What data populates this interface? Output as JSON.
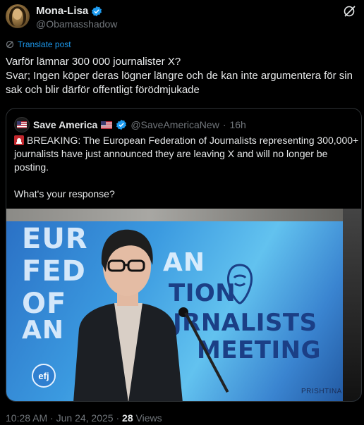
{
  "author": {
    "display_name": "Mona-Lisa",
    "handle": "@Obamasshadow",
    "verified_color": "#1d9bf0"
  },
  "translate_label": "Translate post",
  "post_text_lines": [
    "Varför lämnar 300 000 journalister X?",
    "Svar; Ingen köper deras lögner längre och de kan inte argumentera för sin",
    "sak och blir därför offentligt förödmjukade"
  ],
  "quoted": {
    "display_name": "Save America",
    "handle": "@SaveAmericaNew",
    "separator": "·",
    "time": "16h",
    "text_lines": [
      "BREAKING: The European Federation of Journalists representing 300,000+",
      "journalists have just announced they are leaving X and will no longer be",
      "posting."
    ],
    "question": "What's your response?",
    "media_banner_lines": [
      "EUR",
      "FED",
      "OF",
      "AN"
    ],
    "media_banner_lines_right": [
      "AN",
      "TION",
      "JRNALISTS",
      "MEETING"
    ],
    "media_logo": "efj",
    "media_caption": "PRISHTINA"
  },
  "meta": {
    "time": "10:28 AM",
    "dot": "·",
    "date": "Jun 24, 2025",
    "dot2": "·",
    "views_count": "28",
    "views_label": "Views"
  },
  "icons": [
    "avatar",
    "verified-badge-icon",
    "grok-icon",
    "translate-icon",
    "us-flag-icon",
    "siren-icon"
  ]
}
